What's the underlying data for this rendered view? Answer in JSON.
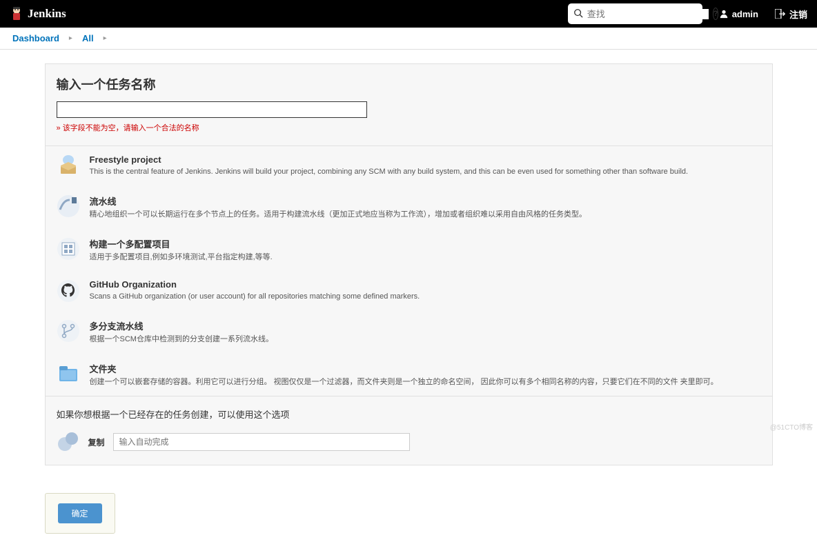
{
  "topbar": {
    "brand": "Jenkins",
    "search_placeholder": "查找",
    "user": "admin",
    "logout": "注销"
  },
  "breadcrumbs": [
    {
      "label": "Dashboard"
    },
    {
      "label": "All"
    }
  ],
  "head": {
    "title": "输入一个任务名称",
    "error": "» 该字段不能为空，请输入一个合法的名称"
  },
  "items": [
    {
      "label": "Freestyle project",
      "desc": "This is the central feature of Jenkins. Jenkins will build your project, combining any SCM with any build system, and this can be even used for something other than software build."
    },
    {
      "label": "流水线",
      "desc": "精心地组织一个可以长期运行在多个节点上的任务。适用于构建流水线（更加正式地应当称为工作流），增加或者组织难以采用自由风格的任务类型。"
    },
    {
      "label": "构建一个多配置项目",
      "desc": "适用于多配置项目,例如多环境测试,平台指定构建,等等."
    },
    {
      "label": "GitHub Organization",
      "desc": "Scans a GitHub organization (or user account) for all repositories matching some defined markers."
    },
    {
      "label": "多分支流水线",
      "desc": "根据一个SCM仓库中检测到的分支创建一系列流水线。"
    },
    {
      "label": "文件夹",
      "desc": "创建一个可以嵌套存储的容器。利用它可以进行分组。 视图仅仅是一个过滤器，而文件夹则是一个独立的命名空间， 因此你可以有多个相同名称的内容，只要它们在不同的文件 夹里即可。"
    }
  ],
  "copy": {
    "hint": "如果你想根据一个已经存在的任务创建，可以使用这个选项",
    "label": "复制",
    "placeholder": "输入自动完成"
  },
  "footer": {
    "ok": "确定"
  },
  "watermark": "@51CTO博客"
}
